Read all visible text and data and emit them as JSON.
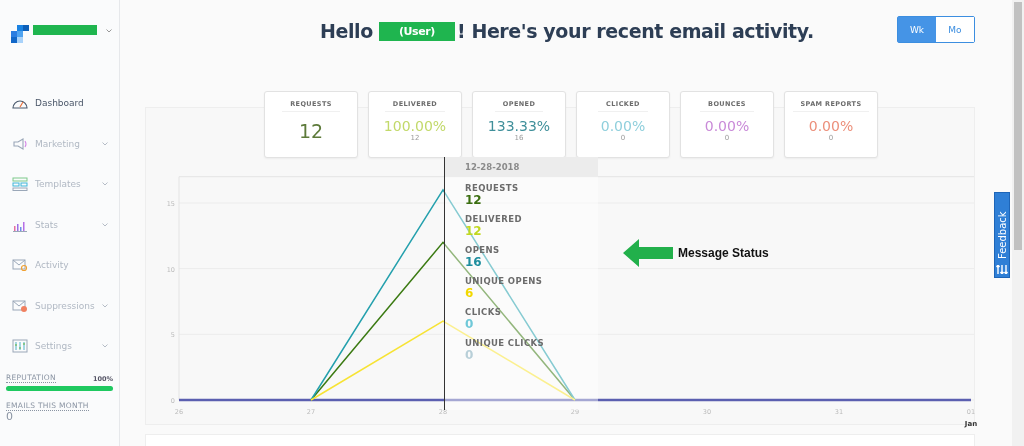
{
  "sidebar": {
    "items": [
      {
        "label": "Dashboard",
        "selected": true,
        "expandable": false
      },
      {
        "label": "Marketing",
        "selected": false,
        "expandable": true
      },
      {
        "label": "Templates",
        "selected": false,
        "expandable": true
      },
      {
        "label": "Stats",
        "selected": false,
        "expandable": true
      },
      {
        "label": "Activity",
        "selected": false,
        "expandable": false
      },
      {
        "label": "Suppressions",
        "selected": false,
        "expandable": true
      },
      {
        "label": "Settings",
        "selected": false,
        "expandable": true
      }
    ],
    "reputation": {
      "label": "REPUTATION",
      "value": "100%",
      "level": 1
    },
    "emails": {
      "label": "EMAILS THIS MONTH",
      "value": "0"
    }
  },
  "header": {
    "greeting": "Hello",
    "user": "(User)",
    "rest": "! Here's your recent email activity.",
    "periods": [
      {
        "label": "Wk",
        "selected": true
      },
      {
        "label": "Mo",
        "selected": false
      }
    ]
  },
  "stat_cards": [
    {
      "label": "REQUESTS",
      "value": "12",
      "color": "#5d7a3a"
    },
    {
      "label": "DELIVERED",
      "value": "100.00%",
      "sub": "12",
      "color": "#c2d96a"
    },
    {
      "label": "OPENED",
      "value": "133.33%",
      "sub": "16",
      "color": "#3f8f9a"
    },
    {
      "label": "CLICKED",
      "value": "0.00%",
      "sub": "0",
      "color": "#8fcfdc"
    },
    {
      "label": "BOUNCES",
      "value": "0.00%",
      "sub": "0",
      "color": "#c98ad8"
    },
    {
      "label": "SPAM REPORTS",
      "value": "0.00%",
      "sub": "0",
      "color": "#ec8f7a"
    }
  ],
  "chart": {
    "month_label": "Jan",
    "chart_data": {
      "type": "line",
      "categories": [
        "26",
        "27",
        "28",
        "29",
        "30",
        "31",
        "01"
      ],
      "yticks": [
        0,
        5,
        10,
        15
      ],
      "ylim": [
        0,
        17
      ],
      "grid": true,
      "series": [
        {
          "color": "#5b5fb0",
          "values": [
            0,
            0,
            0,
            0,
            0,
            0,
            0
          ]
        },
        {
          "color": "#3b7a12",
          "values": [
            null,
            0,
            12,
            0,
            null,
            null,
            null
          ]
        },
        {
          "color": "#24a0ad",
          "values": [
            null,
            0,
            16,
            0,
            null,
            null,
            null
          ]
        },
        {
          "color": "#f7e334",
          "values": [
            null,
            0,
            6,
            0,
            null,
            null,
            null
          ]
        }
      ]
    }
  },
  "tooltip": {
    "date": "12-28-2018",
    "entries": [
      {
        "label": "REQUESTS",
        "value": "12",
        "color": "#3b6e10"
      },
      {
        "label": "DELIVERED",
        "value": "12",
        "color": "#c0d820"
      },
      {
        "label": "OPENS",
        "value": "16",
        "color": "#1f8e9e"
      },
      {
        "label": "UNIQUE OPENS",
        "value": "6",
        "color": "#f2d800"
      },
      {
        "label": "CLICKS",
        "value": "0",
        "color": "#6fc8d8"
      },
      {
        "label": "UNIQUE CLICKS",
        "value": "0",
        "color": "#b8cfd8"
      }
    ]
  },
  "annotation": {
    "text": "Message Status"
  },
  "feedback": {
    "label": "Feedback"
  }
}
